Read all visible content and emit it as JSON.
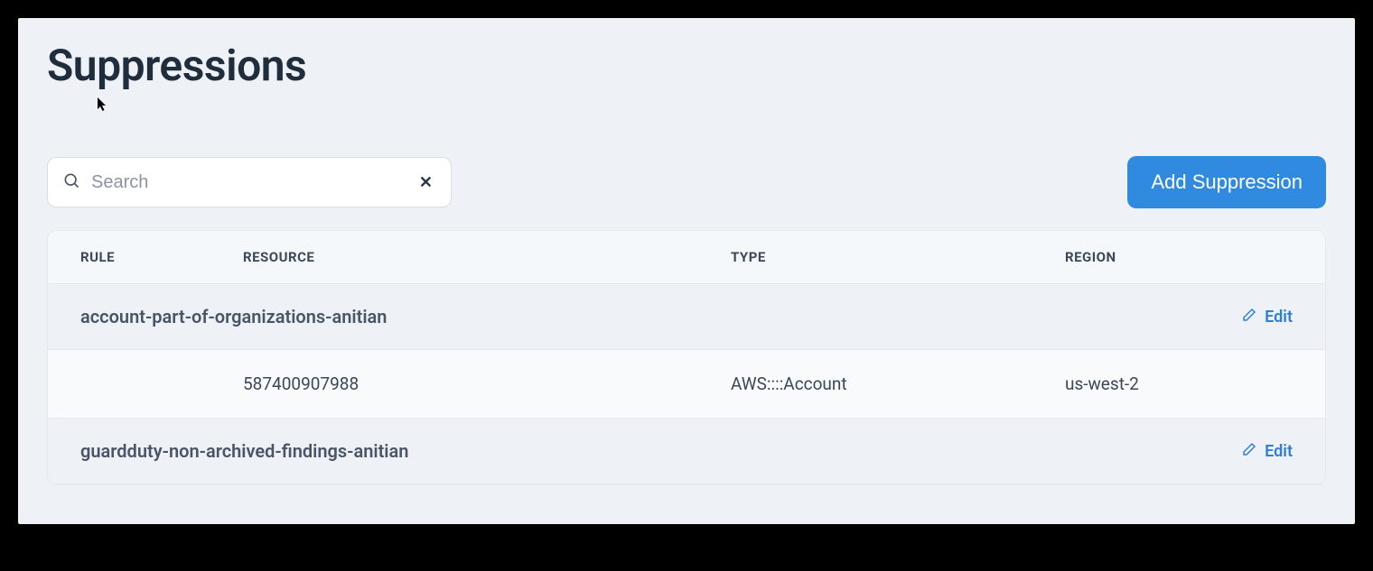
{
  "title": "Suppressions",
  "search": {
    "placeholder": "Search",
    "value": ""
  },
  "actions": {
    "add_label": "Add Suppression",
    "edit_label": "Edit"
  },
  "table": {
    "headers": {
      "rule": "RULE",
      "resource": "RESOURCE",
      "type": "TYPE",
      "region": "REGION"
    },
    "groups": [
      {
        "rule": "account-part-of-organizations-anitian",
        "rows": [
          {
            "resource": "587400907988",
            "type": "AWS::::Account",
            "region": "us-west-2"
          }
        ]
      },
      {
        "rule": "guardduty-non-archived-findings-anitian",
        "rows": []
      }
    ]
  }
}
